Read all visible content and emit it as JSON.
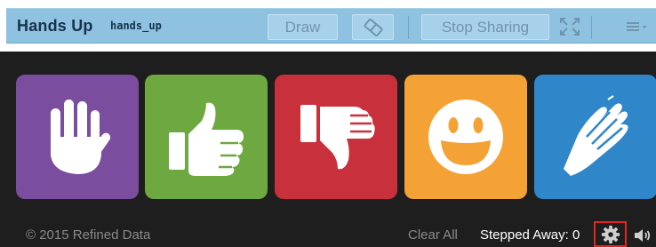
{
  "header": {
    "title": "Hands Up",
    "session_name": "hands_up",
    "draw_label": "Draw",
    "stop_sharing_label": "Stop Sharing",
    "eraser_icon": "eraser-icon",
    "fullscreen_icon": "fullscreen-icon",
    "menu_icon": "hamburger-menu-icon"
  },
  "tiles": [
    {
      "name": "raise-hand",
      "icon": "raised-hand-icon",
      "color": "#7b4d9e"
    },
    {
      "name": "thumbs-up",
      "icon": "thumbs-up-icon",
      "color": "#6ea841"
    },
    {
      "name": "thumbs-down",
      "icon": "thumbs-down-icon",
      "color": "#c8313c"
    },
    {
      "name": "smiley",
      "icon": "smiley-face-icon",
      "color": "#f4a236"
    },
    {
      "name": "clapping",
      "icon": "clapping-hands-icon",
      "color": "#2f86c8"
    }
  ],
  "footer": {
    "copyright": "© 2015 Refined Data",
    "clear_all_label": "Clear All",
    "stepped_away_label": "Stepped Away: 0",
    "settings_icon": "gear-icon",
    "volume_icon": "speaker-icon"
  },
  "colors": {
    "header_bar": "#8fc2e0",
    "background": "#1e1e1e",
    "settings_highlight": "#e3261e"
  }
}
